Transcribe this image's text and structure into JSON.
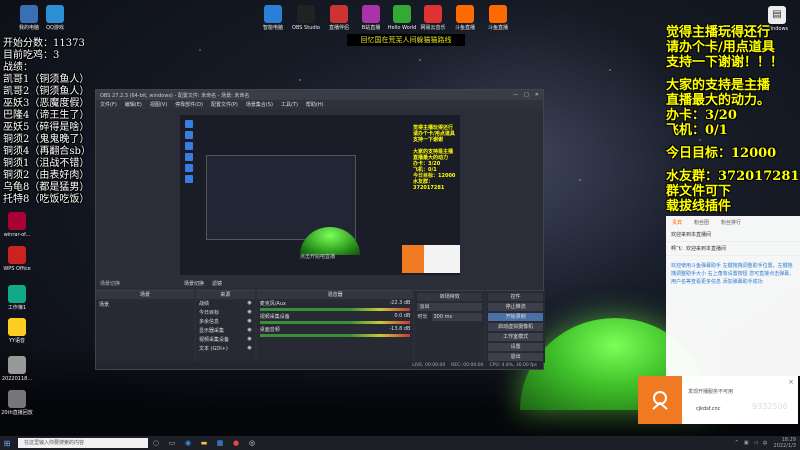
{
  "desktop": {
    "top_icons": [
      {
        "label": "我的电脑",
        "color": "#3a6fb5"
      },
      {
        "label": "QQ游戏",
        "color": "#2b8fd6"
      },
      {
        "label": "智能电脑",
        "color": "#2b7fd6"
      },
      {
        "label": "OBS Studio",
        "color": "#222"
      },
      {
        "label": "直播伴侣",
        "color": "#c33"
      },
      {
        "label": "B站直播",
        "color": "#a3a"
      },
      {
        "label": "Hello World",
        "color": "#3a3"
      },
      {
        "label": "网易云音乐",
        "color": "#d33"
      },
      {
        "label": "斗鱼直播",
        "color": "#ff6a00"
      },
      {
        "label": "斗鱼直播",
        "color": "#ff6a00"
      }
    ],
    "windows_label": "Windows",
    "left_icons": [
      {
        "label": "winrar-of...",
        "color": "#a03"
      },
      {
        "label": "WPS Office",
        "color": "#c22"
      },
      {
        "label": "工作簿1",
        "color": "#1a8"
      },
      {
        "label": "YY语音",
        "color": "#fc2"
      },
      {
        "label": "20220118...",
        "color": "#999"
      },
      {
        "label": "20th直播回放",
        "color": "#777"
      }
    ]
  },
  "stats": {
    "lines": [
      "开始分数：11373",
      "目前吃鸡：3",
      "战绩：",
      "凯哥1（铜须鱼人）",
      "凯哥2（铜须鱼人）",
      "巫妖3（恶魔度假）",
      "巴隆4（谛王生了）",
      "巫妖5（碎得是啥）",
      "铜须2（鬼鬼晚了）",
      "铜须4（再翻合sb）",
      "铜须1（沮战不错）",
      "铜须2（由表好肉）",
      "乌龟8（都是猛男）",
      "托特8（吃饭吃饭）"
    ]
  },
  "banner": "回忆国在荒芜人间躲猫猫路线",
  "right_overlay": {
    "lines": [
      "觉得主播玩得还行",
      "请办个卡/用点道具",
      "支持一下谢谢！！！",
      "",
      "大家的支持是主播",
      "直播最大的动力。",
      "   办卡：3/20",
      "   飞机：0/1",
      "",
      "   今日目标：12000",
      "",
      "水友群：372017281",
      "群文件可下",
      "载拔线插件"
    ]
  },
  "obs": {
    "title": "OBS 27.2.3 (64-bit, windows) - 配置文件: 未命名 - 场景: 未命名",
    "menu": [
      "文件(F)",
      "编辑(E)",
      "视图(V)",
      "停靠部件(D)",
      "配置文件(P)",
      "场景集合(S)",
      "工具(T)",
      "帮助(H)"
    ],
    "scene_ctrl": [
      "场景切换",
      "滤镜"
    ],
    "scenes_title": "场景",
    "scenes": [
      "场景"
    ],
    "sources_title": "来源",
    "sources": [
      "战绩",
      "今日目标",
      "多余信息",
      "显示器采集",
      "视频采集设备",
      "文本 (GDI+)"
    ],
    "mixer_title": "混音器",
    "mixer_tracks": [
      {
        "name": "麦克风/Aux",
        "db": "-22.3 dB"
      },
      {
        "name": "视频采集设备",
        "db": "0.0 dB"
      },
      {
        "name": "桌面音频",
        "db": "-13.8 dB"
      }
    ],
    "trans_title": "转场特效",
    "trans_fade": "淡出",
    "trans_duration_label": "时长",
    "trans_duration": "300 ms",
    "controls_title": "控件",
    "controls": [
      "停止推流",
      "开始录制",
      "启动虚拟摄像机",
      "工作室模式",
      "设置",
      "退出"
    ],
    "preview_text": "点击开始吧直播",
    "status": [
      "LIVE: 00:00:00",
      "REC: 00:00:00",
      "CPU: 4.8%, 30.00 fps"
    ]
  },
  "chat": {
    "tabs": [
      "贵宾",
      "粉丝团",
      "粉丝排行"
    ],
    "messages": [
      "欢迎来到本直播间",
      "啊飞：欢迎来到本直播间"
    ],
    "system": "欢迎使用斗鱼弹幕助手 左键拖拽调整助手位置，左键拖拽调整助手大小 右上角有设置按钮 您可直接点击弹幕、用户名等查看更多信息 添加弹幕助手成功"
  },
  "notification": {
    "title": "发现开播服务不可用",
    "url": "cjkdsf.cnc"
  },
  "watermark_id": "9332506",
  "taskbar": {
    "search_placeholder": "在这里输入你要搜索的内容",
    "time": "18:29",
    "date": "2022/1/3"
  },
  "colors": {
    "accent_yellow": "#ffff00",
    "orange": "#f07a22",
    "tent_green": "#5fe040"
  }
}
